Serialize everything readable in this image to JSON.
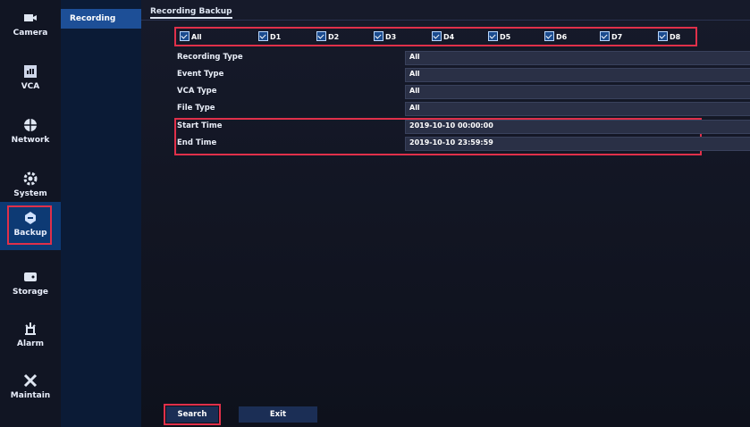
{
  "nav": {
    "items": [
      {
        "label": "Camera",
        "icon": "camera-icon"
      },
      {
        "label": "VCA",
        "icon": "vca-icon"
      },
      {
        "label": "Network",
        "icon": "network-icon"
      },
      {
        "label": "System",
        "icon": "gear-icon"
      },
      {
        "label": "Backup",
        "icon": "backup-icon",
        "active": true
      },
      {
        "label": "Storage",
        "icon": "storage-icon"
      },
      {
        "label": "Alarm",
        "icon": "alarm-icon"
      },
      {
        "label": "Maintain",
        "icon": "tools-icon"
      }
    ]
  },
  "subnav": {
    "active_label": "Recording"
  },
  "tab": {
    "label": "Recording Backup"
  },
  "channels": [
    "All",
    "D1",
    "D2",
    "D3",
    "D4",
    "D5",
    "D6",
    "D7",
    "D8"
  ],
  "form": {
    "recording_type": {
      "label": "Recording Type",
      "value": "All"
    },
    "event_type": {
      "label": "Event Type",
      "value": "All"
    },
    "vca_type": {
      "label": "VCA Type",
      "value": "All"
    },
    "file_type": {
      "label": "File Type",
      "value": "All"
    },
    "start_time": {
      "label": "Start Time",
      "value": "2019-10-10 00:00:00"
    },
    "end_time": {
      "label": "End Time",
      "value": "2019-10-10 23:59:59"
    }
  },
  "buttons": {
    "search": "Search",
    "exit": "Exit"
  },
  "colors": {
    "highlight": "#e0304a",
    "active_nav": "#0d3a74",
    "accent": "#1d4f97"
  }
}
